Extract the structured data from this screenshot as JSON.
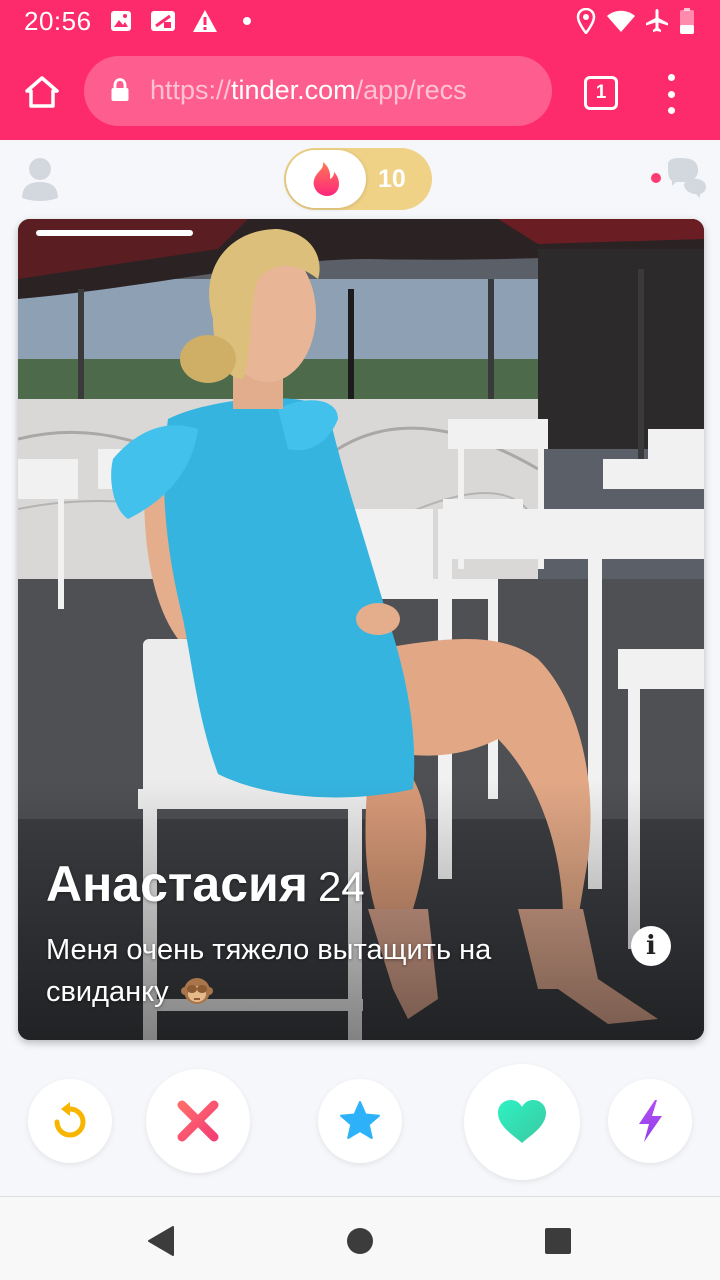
{
  "status_bar": {
    "time": "20:56",
    "left_icons": [
      "gallery-icon",
      "screenshot-icon",
      "warning-icon",
      "dot-icon"
    ],
    "right_icons": [
      "location-icon",
      "wifi-icon",
      "airplane-mode-icon",
      "battery-low-icon"
    ]
  },
  "browser": {
    "url_scheme": "https://",
    "url_host": "tinder.com",
    "url_path": "/app/recs",
    "tab_count": "1"
  },
  "header": {
    "super_like_count": "10"
  },
  "card": {
    "name": "Анастасия",
    "age": "24",
    "bio": "Меня очень тяжело вытащить на свиданку",
    "bio_emoji": "see-no-evil-monkey-emoji",
    "photo_count_indicator": "1 of 1"
  },
  "actions": [
    {
      "name": "rewind-button",
      "icon": "rewind-icon",
      "color": "#f8b500"
    },
    {
      "name": "nope-button",
      "icon": "x-icon",
      "color": "#fe4f5d"
    },
    {
      "name": "super-like-button",
      "icon": "star-icon",
      "color": "#2db2f9"
    },
    {
      "name": "like-button",
      "icon": "heart-icon",
      "color": "#31e6b4"
    },
    {
      "name": "boost-button",
      "icon": "lightning-icon",
      "color": "#a24bf2"
    }
  ],
  "colors": {
    "brand": "#fe2b6c",
    "toggle_gold": "#efd286"
  }
}
